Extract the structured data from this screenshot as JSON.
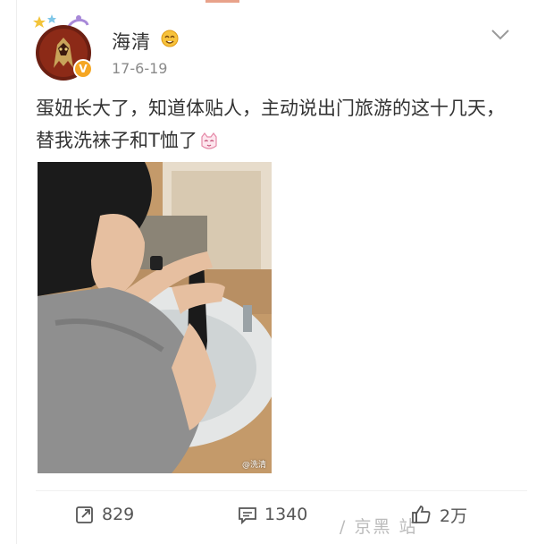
{
  "post": {
    "username": "海清",
    "time": "17-6-19",
    "text": "蛋妞长大了，知道体贴人，主动说出门旅游的这十几天，替我洗袜子和T恤了",
    "photo_watermark": "@洗清"
  },
  "actions": {
    "repost_count": "829",
    "comment_count": "1340",
    "like_count": "2万"
  },
  "overlay": {
    "watermark_text": "/ 京黑 站"
  },
  "icons": {
    "more": "chevron-down-icon",
    "verified": "verified-v-icon",
    "vip": "vip-emoji-icon",
    "inline_emoji": "cat-face-emoji-icon",
    "repost": "repost-icon",
    "comment": "comment-icon",
    "like": "thumbs-up-icon"
  },
  "colors": {
    "verified_badge": "#f5a623",
    "muted_text": "#8a8a8a",
    "main_text": "#333333"
  }
}
